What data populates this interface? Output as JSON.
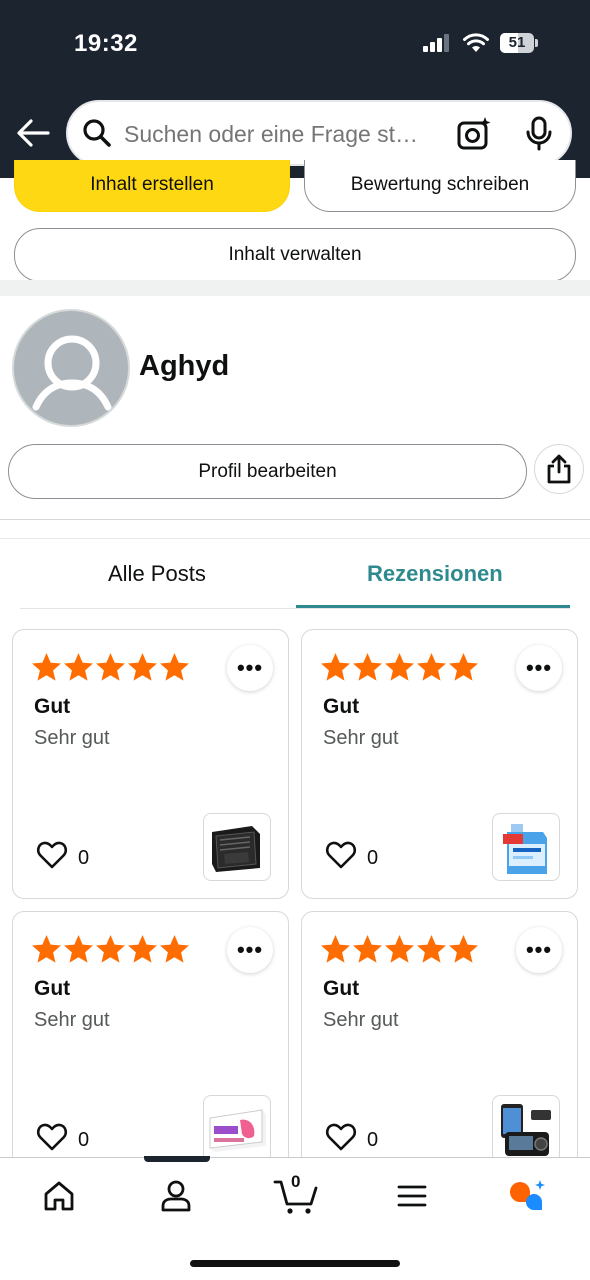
{
  "status_bar": {
    "time": "19:32",
    "battery": "51"
  },
  "search": {
    "placeholder": "Suchen oder eine Frage st…"
  },
  "actions": {
    "create_label": "Inhalt erstellen",
    "review_label": "Bewertung schreiben",
    "manage_label": "Inhalt verwalten"
  },
  "profile": {
    "name": "Aghyd",
    "edit_label": "Profil bearbeiten"
  },
  "tabs": [
    {
      "label": "Alle Posts",
      "active": false
    },
    {
      "label": "Rezensionen",
      "active": true
    }
  ],
  "reviews": [
    {
      "rating": 5,
      "title": "Gut",
      "text": "Sehr gut",
      "likes": "0",
      "product_icon": "wallet-product-image"
    },
    {
      "rating": 5,
      "title": "Gut",
      "text": "Sehr gut",
      "likes": "0",
      "product_icon": "canister-product-image"
    },
    {
      "rating": 5,
      "title": "Gut",
      "text": "Sehr gut",
      "likes": "0",
      "product_icon": "box-product-image"
    },
    {
      "rating": 5,
      "title": "Gut",
      "text": "Sehr gut",
      "likes": "0",
      "product_icon": "dashcam-product-image"
    }
  ],
  "more_glyph": "•••",
  "nav": {
    "cart_count": "0"
  },
  "colors": {
    "header_bg": "#1c2430",
    "primary_button": "#ffd814",
    "accent_teal": "#2f8a8f",
    "star_orange": "#ff6d00"
  }
}
